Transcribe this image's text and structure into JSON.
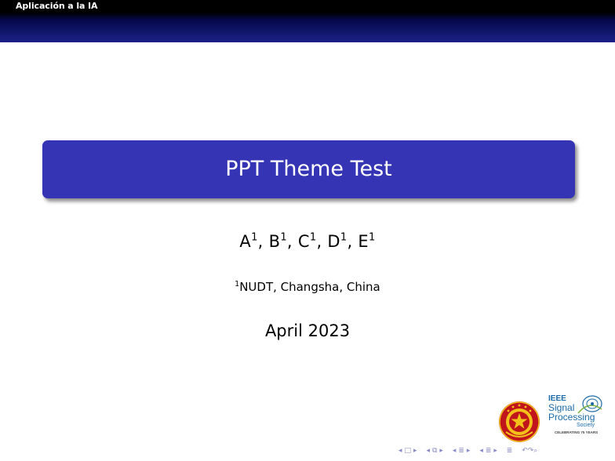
{
  "headline": {
    "section_title": "Aplicación a la IA"
  },
  "title": "PPT Theme Test",
  "authors": [
    {
      "name": "A",
      "sup": "1"
    },
    {
      "name": "B",
      "sup": "1"
    },
    {
      "name": "C",
      "sup": "1"
    },
    {
      "name": "D",
      "sup": "1"
    },
    {
      "name": "E",
      "sup": "1"
    }
  ],
  "affiliation": {
    "sup": "1",
    "text": "NUDT, Changsha, China"
  },
  "date": "April 2023",
  "logos": {
    "ieee": {
      "line1": "IEEE",
      "line2": "Signal",
      "line3": "Processing",
      "line4": "Society",
      "tagline": "CELEBRATING 75 YEARS"
    }
  },
  "navigation": {
    "icons": [
      "nav-left-arrow",
      "nav-frame-icon",
      "nav-right-arrow",
      "nav-subsection-icon",
      "nav-section-icon",
      "nav-appendix-icon",
      "nav-search-icon"
    ],
    "color": "#8a8ac8"
  },
  "colors": {
    "title_box": "#3434b4",
    "header_gradient_end": "#1c2288",
    "headline_bg": "#000000"
  }
}
